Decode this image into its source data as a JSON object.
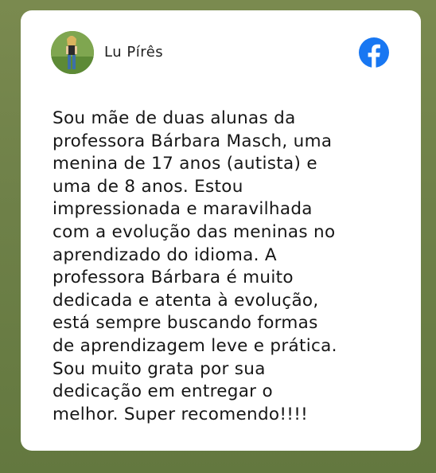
{
  "post": {
    "author_name": "Lu Pírês",
    "text": "Sou mãe de duas alunas da\nprofessora Bárbara Masch, uma\nmenina de 17 anos (autista) e\numa de 8 anos. Estou\nimpressionada e maravilhada\ncom a evolução das meninas no\naprendizado do idioma. A\nprofessora Bárbara é muito\ndedicada e atenta à evolução,\nestá sempre buscando formas\nde aprendizagem leve e prática.\nSou muito grata por sua\ndedicação em entregar o\nmelhor. Super recomendo!!!!",
    "source_icon": "facebook-icon",
    "source_color": "#1877f2"
  },
  "theme": {
    "background": "#6f8149",
    "card": "#ffffff",
    "text": "#161616"
  }
}
